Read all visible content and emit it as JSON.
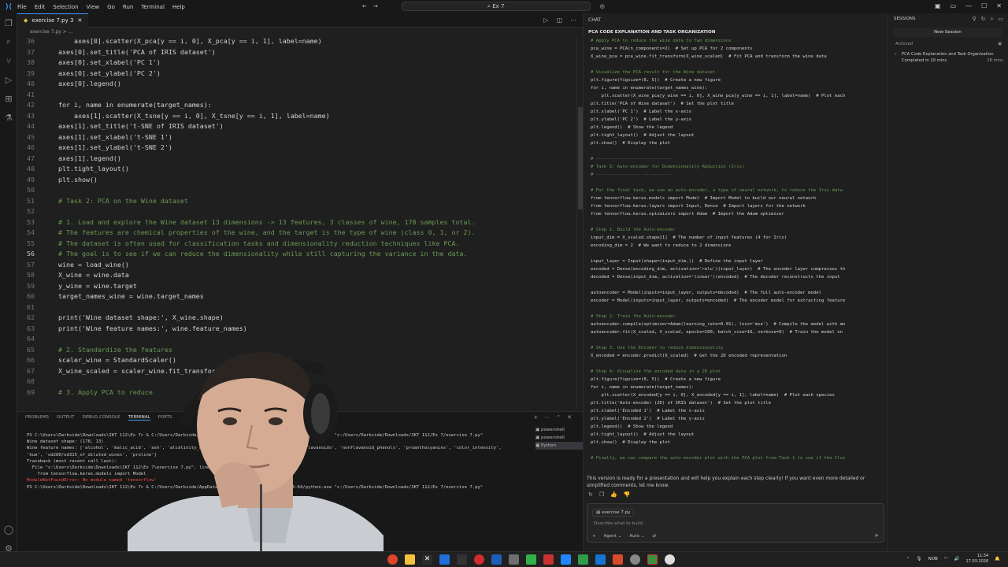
{
  "titlebar": {
    "menu": [
      "File",
      "Edit",
      "Selection",
      "View",
      "Go",
      "Run",
      "Terminal",
      "Help"
    ],
    "search": "Ex 7",
    "window_controls": [
      "minimize-icon",
      "maximize-icon",
      "close-icon"
    ]
  },
  "editor": {
    "tab": {
      "label": "exercise 7.py 3"
    },
    "breadcrumb": "exercise 7.py > ...",
    "active_line": 56,
    "lines": [
      {
        "n": 36,
        "t": "        axes[0].scatter(X_pca[y == i, 0], X_pca[y == i, 1], label=name)",
        "cmt": false
      },
      {
        "n": 37,
        "t": "    axes[0].set_title('PCA of IRIS dataset')",
        "cmt": false
      },
      {
        "n": 38,
        "t": "    axes[0].set_xlabel('PC 1')",
        "cmt": false
      },
      {
        "n": 39,
        "t": "    axes[0].set_ylabel('PC 2')",
        "cmt": false
      },
      {
        "n": 40,
        "t": "    axes[0].legend()",
        "cmt": false
      },
      {
        "n": 41,
        "t": "",
        "cmt": false
      },
      {
        "n": 42,
        "t": "    for i, name in enumerate(target_names):",
        "cmt": false
      },
      {
        "n": 43,
        "t": "        axes[1].scatter(X_tsne[y == i, 0], X_tsne[y == i, 1], label=name)",
        "cmt": false
      },
      {
        "n": 44,
        "t": "    axes[1].set_title('t-SNE of IRIS dataset')",
        "cmt": false
      },
      {
        "n": 45,
        "t": "    axes[1].set_xlabel('t-SNE 1')",
        "cmt": false
      },
      {
        "n": 46,
        "t": "    axes[1].set_ylabel('t-SNE 2')",
        "cmt": false
      },
      {
        "n": 47,
        "t": "    axes[1].legend()",
        "cmt": false
      },
      {
        "n": 48,
        "t": "    plt.tight_layout()",
        "cmt": false
      },
      {
        "n": 49,
        "t": "    plt.show()",
        "cmt": false
      },
      {
        "n": 50,
        "t": "",
        "cmt": false
      },
      {
        "n": 51,
        "t": "    # Task 2: PCA on the Wine dataset",
        "cmt": true
      },
      {
        "n": 52,
        "t": "",
        "cmt": false
      },
      {
        "n": 53,
        "t": "    # 1. Load and explore the Wine dataset 13 dimensions -> 13 features, 3 classes of wine, 178 samples total.",
        "cmt": true
      },
      {
        "n": 54,
        "t": "    # The features are chemical properties of the wine, and the target is the type of wine (class 0, 1, or 2).",
        "cmt": true
      },
      {
        "n": 55,
        "t": "    # The dataset is often used for classification tasks and dimensionality reduction techniques like PCA.",
        "cmt": true
      },
      {
        "n": 56,
        "t": "    # The goal is to see if we can reduce the dimensionality while still capturing the variance in the data.",
        "cmt": true
      },
      {
        "n": 57,
        "t": "    wine = load_wine()",
        "cmt": false
      },
      {
        "n": 58,
        "t": "    X_wine = wine.data",
        "cmt": false
      },
      {
        "n": 59,
        "t": "    y_wine = wine.target",
        "cmt": false
      },
      {
        "n": 60,
        "t": "    target_names_wine = wine.target_names",
        "cmt": false
      },
      {
        "n": 61,
        "t": "",
        "cmt": false
      },
      {
        "n": 62,
        "t": "    print('Wine dataset shape:', X_wine.shape)",
        "cmt": false
      },
      {
        "n": 63,
        "t": "    print('Wine feature names:', wine.feature_names)",
        "cmt": false
      },
      {
        "n": 64,
        "t": "",
        "cmt": false
      },
      {
        "n": 65,
        "t": "    # 2. Standardize the features",
        "cmt": true
      },
      {
        "n": 66,
        "t": "    scaler_wine = StandardScaler()",
        "cmt": false
      },
      {
        "n": 67,
        "t": "    X_wine_scaled = scaler_wine.fit_transform(X_wine)",
        "cmt": false
      },
      {
        "n": 68,
        "t": "",
        "cmt": false
      },
      {
        "n": 69,
        "t": "    # 3. Apply PCA to reduce",
        "cmt": true
      }
    ]
  },
  "terminal": {
    "tabs": [
      "PROBLEMS",
      "OUTPUT",
      "DEBUG CONSOLE",
      "TERMINAL",
      "PORTS"
    ],
    "sessions": [
      "powershell",
      "powershell",
      "Python"
    ],
    "lines": [
      {
        "t": "PS C:\\Users\\Darkside\\Downloads\\IKT 112\\Ex 7> & C:/Users/Darkside/AppData/Local/Python/pythoncore-3.14-64/python.exe \"c:/Users/Darkside/Downloads/IKT 112/Ex 7/exercise 7.py\"",
        "err": false
      },
      {
        "t": "Wine dataset shape: (178, 13)",
        "err": false
      },
      {
        "t": "Wine feature names: ['alcohol', 'malic_acid', 'ash', 'alcalinity_of_ash', 'magnesium', 'total_phenols', 'flavanoids', 'nonflavanoid_phenols', 'proanthocyanins', 'color_intensity', ",
        "err": false
      },
      {
        "t": "'hue', 'od280/od315_of_diluted_wines', 'proline']",
        "err": false
      },
      {
        "t": "Traceback (most recent call last):",
        "err": false
      },
      {
        "t": "  File \"c:\\Users\\Darkside\\Downloads\\IKT 112\\Ex 7\\exercise 7.py\", line 1",
        "err": false
      },
      {
        "t": "    from tensorflow.keras.models import Model",
        "err": false
      },
      {
        "t": "ModuleNotFoundError: No module named 'tensorflow'",
        "err": true
      },
      {
        "t": "PS C:\\Users\\Darkside\\Downloads\\IKT 112\\Ex 7> & C:/Users/Darkside/AppData/Local/Python/pythoncore-3.14-64/python.exe \"c:/Users/Darkside/Downloads/IKT 112/Ex 7/exercise 7.py\"",
        "err": false
      }
    ]
  },
  "chat": {
    "header": "CHAT",
    "title": "PCA CODE EXPLANATION AND TASK ORGANIZATION",
    "lines": [
      {
        "t": "# Apply PCA to reduce the wine data to two dimensions",
        "c": true
      },
      {
        "t": "pca_wine = PCA(n_components=2)  # Set up PCA for 2 components",
        "c": false
      },
      {
        "t": "X_wine_pca = pca_wine.fit_transform(X_wine_scaled)  # Fit PCA and transform the wine data",
        "c": false
      },
      {
        "t": "",
        "c": false
      },
      {
        "t": "# Visualize the PCA result for the Wine dataset",
        "c": true
      },
      {
        "t": "plt.figure(figsize=(8, 5))  # Create a new figure",
        "c": false
      },
      {
        "t": "for i, name in enumerate(target_names_wine):",
        "c": false
      },
      {
        "t": "    plt.scatter(X_wine_pca[y_wine == i, 0], X_wine_pca[y_wine == i, 1], label=name)  # Plot each",
        "c": false
      },
      {
        "t": "plt.title('PCA of Wine dataset')  # Set the plot title",
        "c": false
      },
      {
        "t": "plt.xlabel('PC 1')  # Label the x-axis",
        "c": false
      },
      {
        "t": "plt.ylabel('PC 2')  # Label the y-axis",
        "c": false
      },
      {
        "t": "plt.legend()  # Show the legend",
        "c": false
      },
      {
        "t": "plt.tight_layout()  # Adjust the layout",
        "c": false
      },
      {
        "t": "plt.show()  # Display the plot",
        "c": false
      },
      {
        "t": "",
        "c": false
      },
      {
        "t": "# -----------------------------",
        "c": true
      },
      {
        "t": "# Task 3: Auto-encoder for Dimensionality Reduction (Iris)",
        "c": true
      },
      {
        "t": "# -----------------------------",
        "c": true
      },
      {
        "t": "",
        "c": false
      },
      {
        "t": "# For the final task, we use an auto-encoder, a type of neural network, to reduce the Iris data",
        "c": true
      },
      {
        "t": "from tensorflow.keras.models import Model  # Import Model to build our neural network",
        "c": false
      },
      {
        "t": "from tensorflow.keras.layers import Input, Dense  # Import layers for the network",
        "c": false
      },
      {
        "t": "from tensorflow.keras.optimizers import Adam  # Import the Adam optimizer",
        "c": false
      },
      {
        "t": "",
        "c": false
      },
      {
        "t": "# Step 1: Build the Auto-encoder",
        "c": true
      },
      {
        "t": "input_dim = X_scaled.shape[1]  # The number of input features (4 for Iris)",
        "c": false
      },
      {
        "t": "encoding_dim = 2  # We want to reduce to 2 dimensions",
        "c": false
      },
      {
        "t": "",
        "c": false
      },
      {
        "t": "input_layer = Input(shape=(input_dim,))  # Define the input layer",
        "c": false
      },
      {
        "t": "encoded = Dense(encoding_dim, activation='relu')(input_layer)  # The encoder layer compresses th",
        "c": false
      },
      {
        "t": "decoded = Dense(input_dim, activation='linear')(encoded)  # The decoder reconstructs the input",
        "c": false
      },
      {
        "t": "",
        "c": false
      },
      {
        "t": "autoencoder = Model(inputs=input_layer, outputs=decoded)  # The full auto-encoder model",
        "c": false
      },
      {
        "t": "encoder = Model(inputs=input_layer, outputs=encoded)  # The encoder model for extracting feature",
        "c": false
      },
      {
        "t": "",
        "c": false
      },
      {
        "t": "# Step 2: Train the Auto-encoder",
        "c": true
      },
      {
        "t": "autoencoder.compile(optimizer=Adam(learning_rate=0.01), loss='mse')  # Compile the model with mo",
        "c": false
      },
      {
        "t": "autoencoder.fit(X_scaled, X_scaled, epochs=100, batch_size=16, verbose=0)  # Train the model on",
        "c": false
      },
      {
        "t": "",
        "c": false
      },
      {
        "t": "# Step 3: Use the Encoder to reduce dimensionality",
        "c": true
      },
      {
        "t": "X_encoded = encoder.predict(X_scaled)  # Get the 2D encoded representation",
        "c": false
      },
      {
        "t": "",
        "c": false
      },
      {
        "t": "# Step 4: Visualize the encoded data in a 2D plot",
        "c": true
      },
      {
        "t": "plt.figure(figsize=(8, 5))  # Create a new figure",
        "c": false
      },
      {
        "t": "for i, name in enumerate(target_names):",
        "c": false
      },
      {
        "t": "    plt.scatter(X_encoded[y == i, 0], X_encoded[y == i, 1], label=name)  # Plot each species",
        "c": false
      },
      {
        "t": "plt.title('Auto-encoder (2D) of IRIS dataset')  # Set the plot title",
        "c": false
      },
      {
        "t": "plt.xlabel('Encoded 1')  # Label the x-axis",
        "c": false
      },
      {
        "t": "plt.ylabel('Encoded 2')  # Label the y-axis",
        "c": false
      },
      {
        "t": "plt.legend()  # Show the legend",
        "c": false
      },
      {
        "t": "plt.tight_layout()  # Adjust the layout",
        "c": false
      },
      {
        "t": "plt.show()  # Display the plot",
        "c": false
      },
      {
        "t": "",
        "c": false
      },
      {
        "t": "# Finally, we can compare the auto-encoder plot with the PCA plot from Task 1 to see if the Clus",
        "c": true
      }
    ],
    "note": "This version is ready for a presentation and will help you explain each step clearly! If you want even more detailed or simplified comments, let me know.",
    "input": {
      "file_chip": "exercise 7.py",
      "placeholder": "Describe what to build",
      "mode": "Agent",
      "model": "Auto"
    }
  },
  "sessions": {
    "header": "SESSIONS",
    "new_session": "New Session",
    "archived_label": "Archived",
    "items": [
      {
        "title": "PCA Code Explanation and Task Organization",
        "status": "Completed in 10 mins",
        "time": "18 mins"
      }
    ]
  },
  "taskbar": {
    "lang": "NOB",
    "time": "11:34",
    "date": "17.03.2026"
  },
  "colors": {
    "accent": "#3b9bff",
    "comment": "#6a9955",
    "error": "#f14c4c"
  }
}
